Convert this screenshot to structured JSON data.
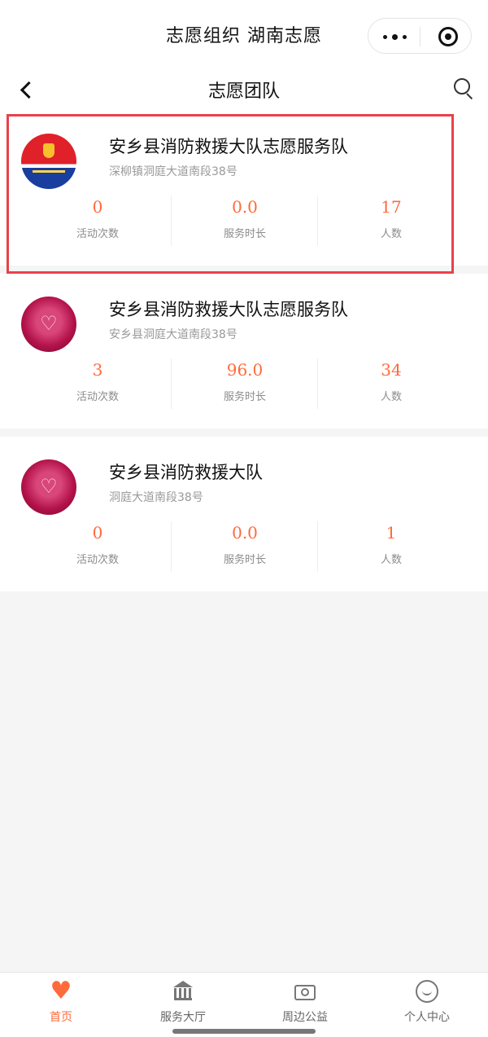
{
  "app": {
    "title": "志愿组织 湖南志愿"
  },
  "nav": {
    "title": "志愿团队"
  },
  "teams": [
    {
      "name": "安乡县消防救援大队志愿服务队",
      "address": "深柳镇洞庭大道南段38号",
      "avatar_icon": "fire-rescue-emblem",
      "stats": [
        {
          "value": "0",
          "label": "活动次数"
        },
        {
          "value": "0.0",
          "label": "服务时长"
        },
        {
          "value": "17",
          "label": "人数"
        }
      ]
    },
    {
      "name": "安乡县消防救援大队志愿服务队",
      "address": "安乡县洞庭大道南段38号",
      "avatar_icon": "volunteer-heart",
      "stats": [
        {
          "value": "3",
          "label": "活动次数"
        },
        {
          "value": "96.0",
          "label": "服务时长"
        },
        {
          "value": "34",
          "label": "人数"
        }
      ]
    },
    {
      "name": "安乡县消防救援大队",
      "address": "洞庭大道南段38号",
      "avatar_icon": "volunteer-heart",
      "stats": [
        {
          "value": "0",
          "label": "活动次数"
        },
        {
          "value": "0.0",
          "label": "服务时长"
        },
        {
          "value": "1",
          "label": "人数"
        }
      ]
    }
  ],
  "tabbar": {
    "items": [
      {
        "label": "首页",
        "icon": "heart-icon",
        "active": true
      },
      {
        "label": "服务大厅",
        "icon": "bank-icon",
        "active": false
      },
      {
        "label": "周边公益",
        "icon": "camera-icon",
        "active": false
      },
      {
        "label": "个人中心",
        "icon": "smile-icon",
        "active": false
      }
    ]
  },
  "colors": {
    "accent": "#ff6a3c",
    "highlight_border": "#e8414b"
  }
}
